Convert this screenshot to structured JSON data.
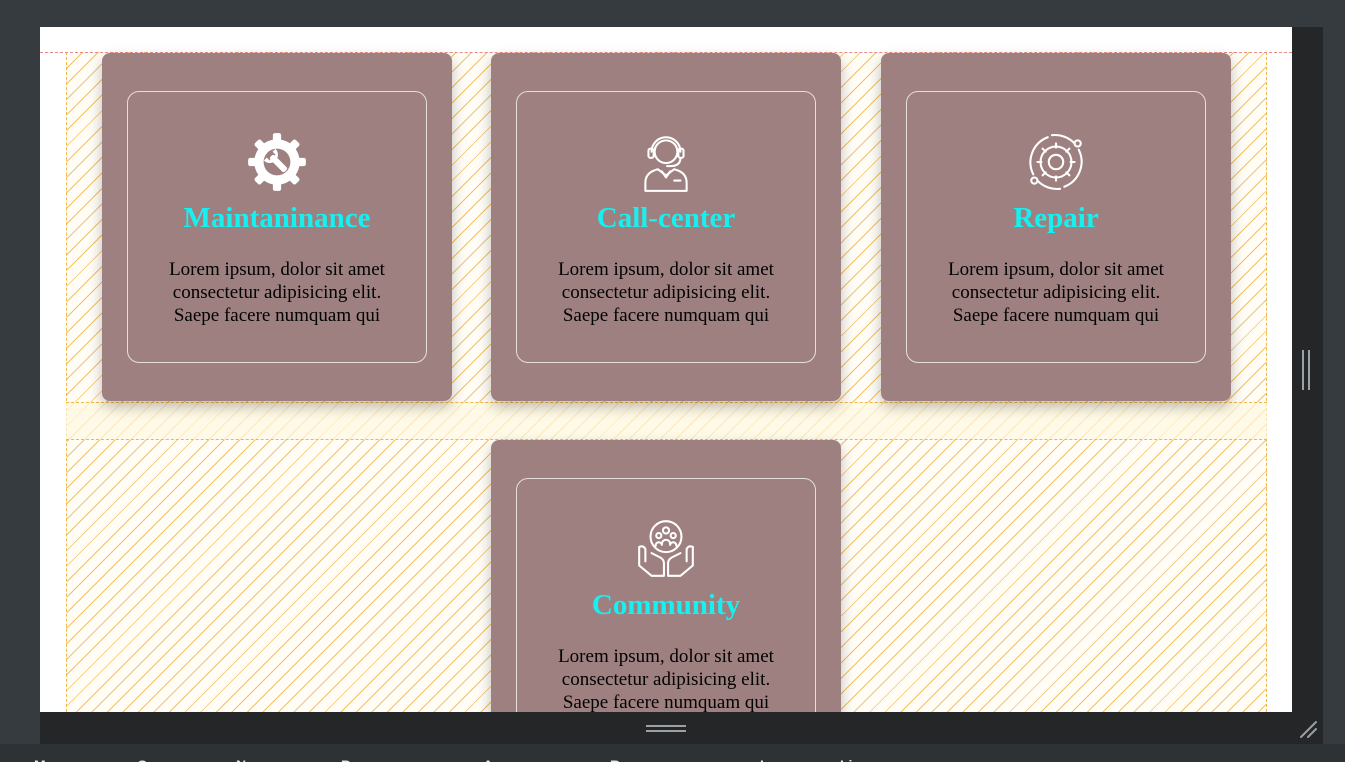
{
  "services": [
    {
      "icon": "gear-wrench-icon",
      "title": "Maintaninance",
      "text": "Lorem ipsum, dolor sit amet consectetur adipisicing elit. Saepe facere numquam qui"
    },
    {
      "icon": "headset-agent-icon",
      "title": "Call-center",
      "text": "Lorem ipsum, dolor sit amet consectetur adipisicing elit. Saepe facere numquam qui"
    },
    {
      "icon": "gear-cycle-icon",
      "title": "Repair",
      "text": "Lorem ipsum, dolor sit amet consectetur adipisicing elit. Saepe facere numquam qui"
    },
    {
      "icon": "community-hands-icon",
      "title": "Community",
      "text": "Lorem ipsum, dolor sit amet consectetur adipisicing elit. Saepe facere numquam qui"
    }
  ],
  "devtools_tabs": [
    "M",
    "C",
    "N",
    "P",
    "A",
    "R",
    "L",
    "Li"
  ],
  "colors": {
    "card_bg": "#9e8080",
    "title": "#16f0f0",
    "grid_overlay": "#f0b84a",
    "editor_bg": "#353b3e"
  }
}
